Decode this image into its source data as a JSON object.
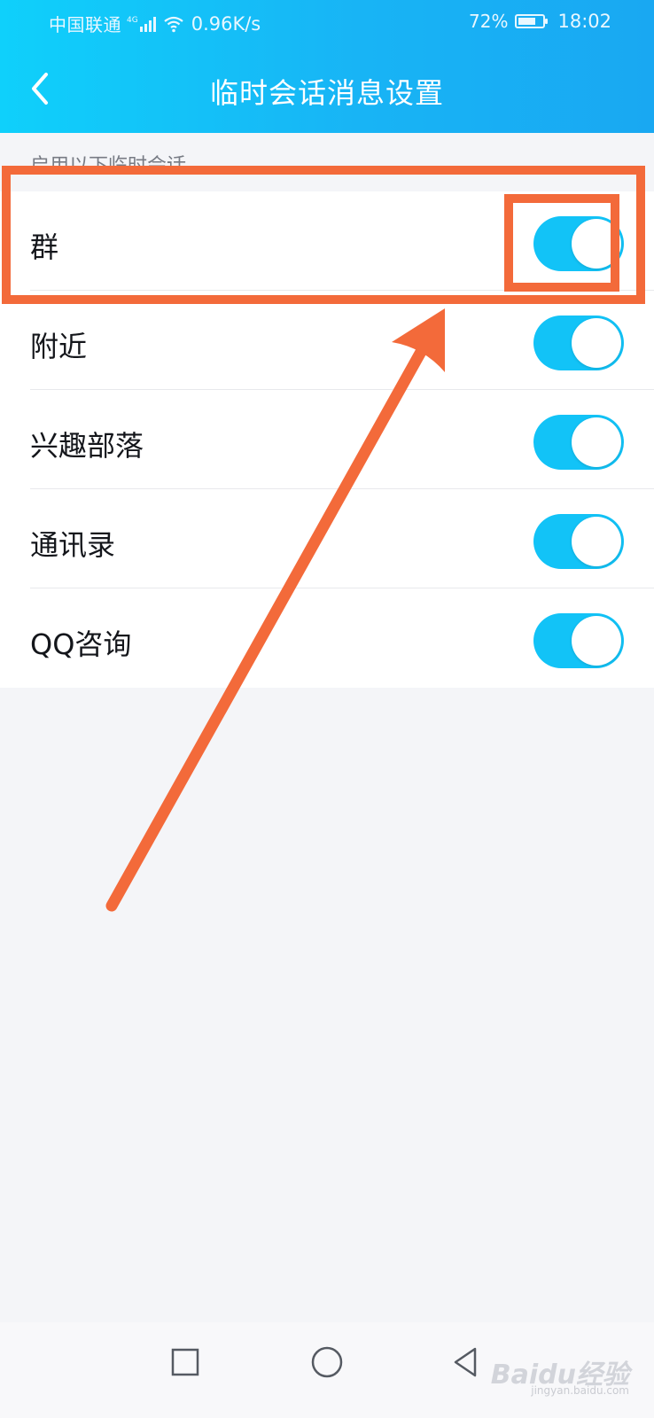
{
  "status_bar": {
    "carrier": "中国联通",
    "network": "4G",
    "speed": "0.96K/s",
    "battery_pct": "72%",
    "battery_level": 0.72,
    "time": "18:02",
    "icons": [
      "signal-icon",
      "wifi-icon",
      "battery-icon"
    ]
  },
  "header": {
    "title": "临时会话消息设置",
    "back_icon": "chevron-left-icon",
    "accent_color": "#16b9f6"
  },
  "section": {
    "label": "启用以下临时会话"
  },
  "settings": {
    "items": [
      {
        "label": "群",
        "enabled": true
      },
      {
        "label": "附近",
        "enabled": true
      },
      {
        "label": "兴趣部落",
        "enabled": true
      },
      {
        "label": "通讯录",
        "enabled": true
      },
      {
        "label": "QQ咨询",
        "enabled": true
      }
    ],
    "toggle_on_color": "#12c3f7"
  },
  "system_nav": {
    "icons": [
      "square-recent-icon",
      "circle-home-icon",
      "triangle-back-icon"
    ]
  },
  "annotation": {
    "color": "#f36a3a"
  },
  "watermark": {
    "brand": "Baidu经验",
    "domain": "jingyan.baidu.com"
  }
}
